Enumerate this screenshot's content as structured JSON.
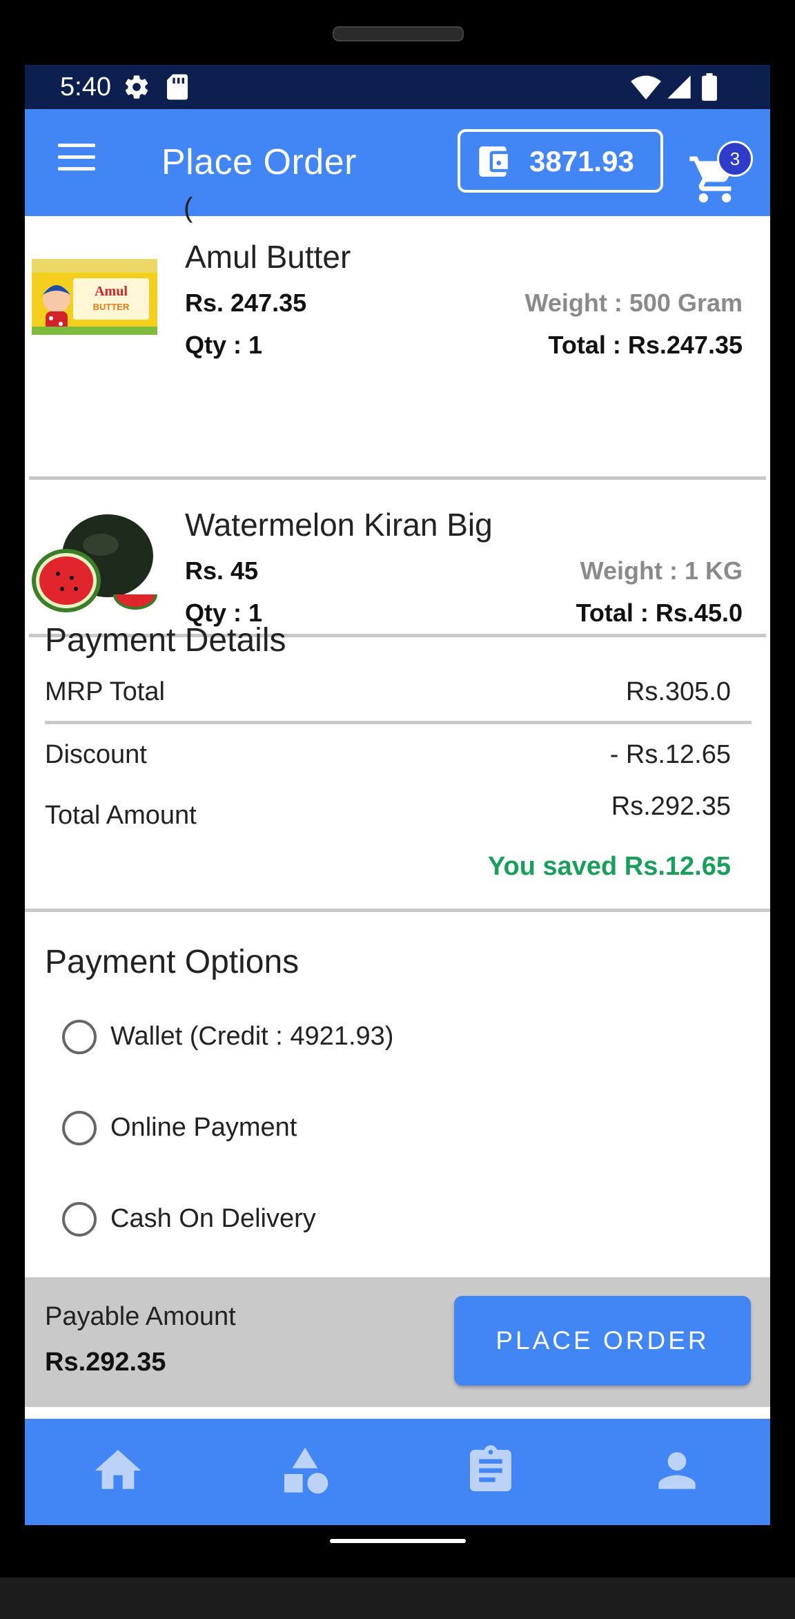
{
  "status_bar": {
    "time": "5:40"
  },
  "app_bar": {
    "title": "Place Order",
    "wallet_amount": "3871.93",
    "cart_count": "3"
  },
  "items": [
    {
      "name": "Amul Butter",
      "price": "Rs. 247.35",
      "qty": "Qty : 1",
      "weight": "Weight : 500 Gram",
      "total": "Total : Rs.247.35",
      "thumb_brand": "Amul",
      "thumb_product": "BUTTER"
    },
    {
      "name": "Watermelon Kiran Big",
      "price": "Rs. 45",
      "qty": "Qty : 1",
      "weight": "Weight : 1 KG",
      "total": "Total : Rs.45.0"
    }
  ],
  "payment_details": {
    "title": "Payment Details",
    "mrp_label": "MRP Total",
    "mrp_value": "Rs.305.0",
    "discount_label": "Discount",
    "discount_value": "- Rs.12.65",
    "total_label": "Total Amount",
    "total_value": "Rs.292.35",
    "saved_text": "You saved Rs.12.65"
  },
  "payment_options": {
    "title": "Payment Options",
    "options": [
      "Wallet (Credit : 4921.93)",
      "Online Payment",
      "Cash On Delivery"
    ]
  },
  "checkout": {
    "payable_label": "Payable Amount",
    "payable_amount": "Rs.292.35",
    "button_label": "PLACE ORDER"
  },
  "bottom_nav": {
    "items": [
      "home-icon",
      "categories-icon",
      "orders-icon",
      "profile-icon"
    ]
  },
  "colors": {
    "primary": "#4285f4",
    "status_bar": "#0c1f4e",
    "saved_green": "#1a9e5c",
    "badge": "#2e3cc9",
    "checkout_bar": "#c9c9c9"
  }
}
